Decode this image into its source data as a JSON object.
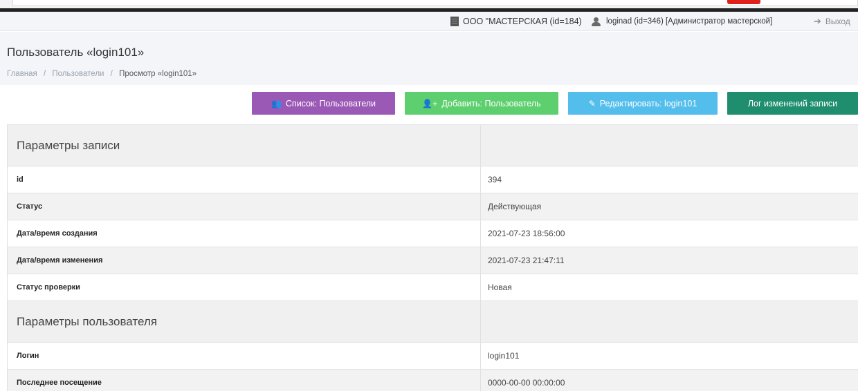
{
  "topbar": {
    "organization": "ООО \"МАСТЕРСКАЯ (id=184)",
    "user": "loginad (id=346) [Администратор мастерской]",
    "logout": "Выход"
  },
  "header": {
    "title": "Пользователь «login101»",
    "breadcrumb": [
      {
        "label": "Главная"
      },
      {
        "label": "Пользователи"
      },
      {
        "label": "Просмотр «login101»"
      }
    ]
  },
  "actions": {
    "list": "Список: Пользователи",
    "add": "Добавить: Пользователь",
    "edit": "Редактировать: login101",
    "log": "Лог изменений записи"
  },
  "sections": [
    {
      "title": "Параметры записи",
      "rows": [
        {
          "label": "id",
          "value": "394"
        },
        {
          "label": "Статус",
          "value": "Действующая"
        },
        {
          "label": "Дата/время создания",
          "value": "2021-07-23 18:56:00"
        },
        {
          "label": "Дата/время изменения",
          "value": "2021-07-23 21:47:11"
        },
        {
          "label": "Статус проверки",
          "value": "Новая"
        }
      ]
    },
    {
      "title": "Параметры пользователя",
      "rows": [
        {
          "label": "Логин",
          "value": "login101"
        },
        {
          "label": "Последнее посещение",
          "value": "0000-00-00 00:00:00"
        }
      ]
    }
  ]
}
